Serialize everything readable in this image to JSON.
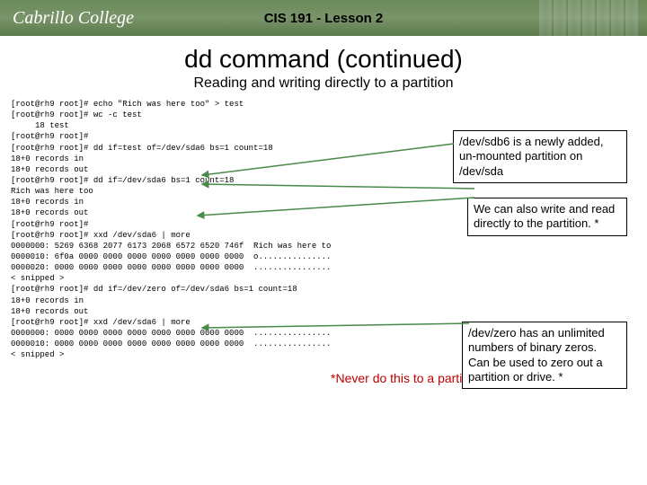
{
  "banner": {
    "logo": "Cabrillo College",
    "title": "CIS 191 - Lesson 2"
  },
  "slide": {
    "title": "dd command (continued)",
    "subtitle": "Reading and writing directly to a partition",
    "terminal": "[root@rh9 root]# echo \"Rich was here too\" > test\n[root@rh9 root]# wc -c test\n     18 test\n[root@rh9 root]#\n[root@rh9 root]# dd if=test of=/dev/sda6 bs=1 count=18\n18+0 records in\n18+0 records out\n[root@rh9 root]# dd if=/dev/sda6 bs=1 count=18\nRich was here too\n18+0 records in\n18+0 records out\n[root@rh9 root]#\n[root@rh9 root]# xxd /dev/sda6 | more\n0000000: 5269 6368 2077 6173 2068 6572 6520 746f  Rich was here to\n0000010: 6f0a 0000 0000 0000 0000 0000 0000 0000  o...............\n0000020: 0000 0000 0000 0000 0000 0000 0000 0000  ................\n< snipped >\n[root@rh9 root]# dd if=/dev/zero of=/dev/sda6 bs=1 count=18\n18+0 records in\n18+0 records out\n[root@rh9 root]# xxd /dev/sda6 | more\n0000000: 0000 0000 0000 0000 0000 0000 0000 0000  ................\n0000010: 0000 0000 0000 0000 0000 0000 0000 0000  ................\n< snipped >",
    "callout1": "/dev/sdb6 is a newly added, un-mounted partition on /dev/sda",
    "callout2": "We can also write and read directly to the partition. *",
    "callout3": "/dev/zero has an unlimited numbers of binary zeros. Can be used to zero out a partition or drive. *",
    "footnote": "*Never do this to a partition containing important data"
  }
}
